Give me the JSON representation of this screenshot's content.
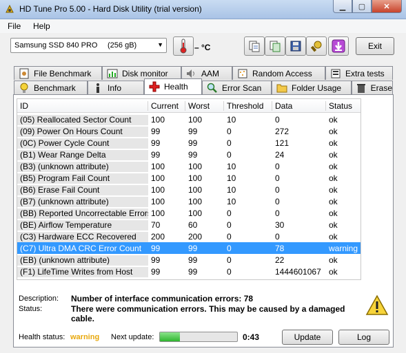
{
  "window": {
    "title": "HD Tune Pro 5.00 - Hard Disk Utility (trial version)"
  },
  "menu": {
    "file": "File",
    "help": "Help"
  },
  "toolbar": {
    "drive": "Samsung SSD 840 PRO",
    "drive_size": "(256 gB)",
    "temperature": "– °C",
    "exit_label": "Exit"
  },
  "tabs_top": [
    "File Benchmark",
    "Disk monitor",
    "AAM",
    "Random Access",
    "Extra tests"
  ],
  "tabs_bottom": [
    "Benchmark",
    "Info",
    "Health",
    "Error Scan",
    "Folder Usage",
    "Erase"
  ],
  "active_tab": "Health",
  "table": {
    "headers": [
      "ID",
      "Current",
      "Worst",
      "Threshold",
      "Data",
      "Status"
    ],
    "rows": [
      [
        "(05) Reallocated Sector Count",
        "100",
        "100",
        "10",
        "0",
        "ok"
      ],
      [
        "(09) Power On Hours Count",
        "99",
        "99",
        "0",
        "272",
        "ok"
      ],
      [
        "(0C) Power Cycle Count",
        "99",
        "99",
        "0",
        "121",
        "ok"
      ],
      [
        "(B1) Wear Range Delta",
        "99",
        "99",
        "0",
        "24",
        "ok"
      ],
      [
        "(B3) (unknown attribute)",
        "100",
        "100",
        "10",
        "0",
        "ok"
      ],
      [
        "(B5) Program Fail Count",
        "100",
        "100",
        "10",
        "0",
        "ok"
      ],
      [
        "(B6) Erase Fail Count",
        "100",
        "100",
        "10",
        "0",
        "ok"
      ],
      [
        "(B7) (unknown attribute)",
        "100",
        "100",
        "10",
        "0",
        "ok"
      ],
      [
        "(BB) Reported Uncorrectable Errors",
        "100",
        "100",
        "0",
        "0",
        "ok"
      ],
      [
        "(BE) Airflow Temperature",
        "70",
        "60",
        "0",
        "30",
        "ok"
      ],
      [
        "(C3) Hardware ECC Recovered",
        "200",
        "200",
        "0",
        "0",
        "ok"
      ],
      [
        "(C7) Ultra DMA CRC Error Count",
        "99",
        "99",
        "0",
        "78",
        "warning"
      ],
      [
        "(EB) (unknown attribute)",
        "99",
        "99",
        "0",
        "22",
        "ok"
      ],
      [
        "(F1) LifeTime Writes from Host",
        "99",
        "99",
        "0",
        "1444601067",
        "ok"
      ]
    ],
    "selected_row": 11
  },
  "details": {
    "description_label": "Description:",
    "description_value": "Number of interface communication errors: 78",
    "status_label": "Status:",
    "status_line1": "There were communication errors. This may be caused by a damaged",
    "status_line2": "cable."
  },
  "footer": {
    "health_label": "Health status:",
    "health_value": "warning",
    "next_update_label": "Next update:",
    "next_update_progress": 0.26,
    "time": "0:43",
    "update_button": "Update",
    "log_button": "Log"
  },
  "colors": {
    "warning": "#e8a80c",
    "selection": "#3399ff",
    "progress": "#2fb52f"
  }
}
